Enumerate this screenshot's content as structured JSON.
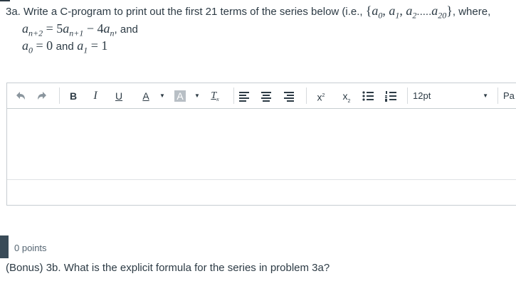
{
  "question_3a": {
    "intro": "3a. Write a C-program to print out the first 21 terms of the series below (i.e., ",
    "series_open": "{",
    "terms": [
      "a",
      "0",
      "a",
      "1",
      "a",
      "2",
      ".....",
      "a",
      "20"
    ],
    "series_close": "}",
    "after": ", where,",
    "recurrence": {
      "lhs": "a",
      "lhs_sub": "n+2",
      "eq": "=",
      "coef1": "5",
      "t1": "a",
      "t1_sub": "n+1",
      "minus": "−",
      "coef2": "4",
      "t2": "a",
      "t2_sub": "n",
      "tail": ", and"
    },
    "initial": {
      "a0": "a",
      "a0_sub": "0",
      "eq1": "=",
      "v0": "0",
      "and": "and",
      "a1": "a",
      "a1_sub": "1",
      "eq2": "=",
      "v1": "1"
    }
  },
  "toolbar": {
    "undo_icon": "undo-icon",
    "redo_icon": "redo-icon",
    "bold": "B",
    "italic": "I",
    "underline": "U",
    "font_color": "A",
    "background_color": "A",
    "clear_format": "T",
    "superscript": "x",
    "subscript": "x",
    "font_size": "12pt",
    "paragraph": "Pa"
  },
  "question_3b": {
    "points": "0 points",
    "text": "(Bonus) 3b. What is the explicit formula for the series in problem 3a?"
  },
  "colors": {
    "text": "#2d3b45",
    "border": "#c7cdd1",
    "muted": "#8b969e",
    "marker": "#394b58"
  }
}
